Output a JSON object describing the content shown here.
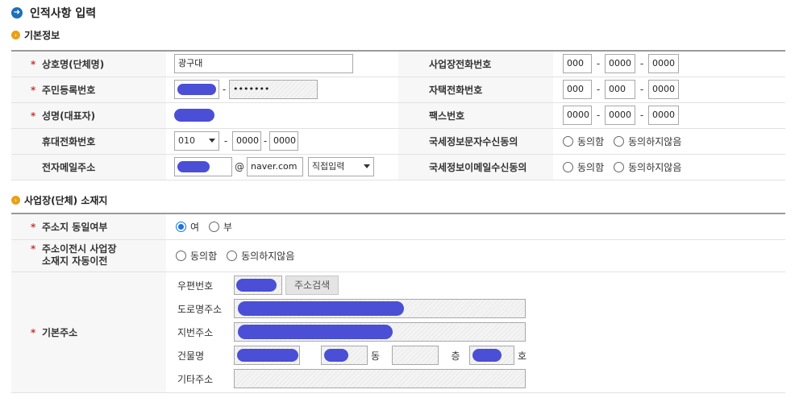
{
  "page": {
    "title": "인적사항 입력"
  },
  "basic": {
    "section_title": "기본정보",
    "labels": {
      "company_name": "상호명(단체명)",
      "resident_no": "주민등록번호",
      "rep_name": "성명(대표자)",
      "mobile": "휴대전화번호",
      "email": "전자메일주소",
      "biz_phone": "사업장전화번호",
      "home_phone": "자택전화번호",
      "fax": "팩스번호",
      "sms_consent": "국세정보문자수신동의",
      "email_consent": "국세정보이메일수신동의"
    },
    "company_name_value": "광구대",
    "resident_no_masked": "•••••••",
    "mobile_prefix": "010",
    "mobile_mid": "0000",
    "mobile_last": "0000",
    "email_at": "@",
    "email_domain": "naver.com",
    "email_select": "직접입력",
    "biz_phone": [
      "000",
      "0000",
      "0000"
    ],
    "home_phone": [
      "000",
      "000",
      "0000"
    ],
    "fax": [
      "0000",
      "0000",
      "0000"
    ],
    "dash": "-",
    "agree": "동의함",
    "disagree": "동의하지않음"
  },
  "location": {
    "section_title": "사업장(단체) 소재지",
    "labels": {
      "same_address": "주소지 동일여부",
      "auto_move_1": "주소이전시 사업장",
      "auto_move_2": "소재지 자동이전",
      "base_address": "기본주소"
    },
    "yes": "여",
    "no": "부",
    "agree": "동의함",
    "disagree": "동의하지않음",
    "postal_code": "우편번호",
    "address_search": "주소검색",
    "road_address": "도로명주소",
    "lot_address": "지번주소",
    "building_name": "건물명",
    "dong": "동",
    "floor": "층",
    "ho": "호",
    "other_address": "기타주소"
  }
}
